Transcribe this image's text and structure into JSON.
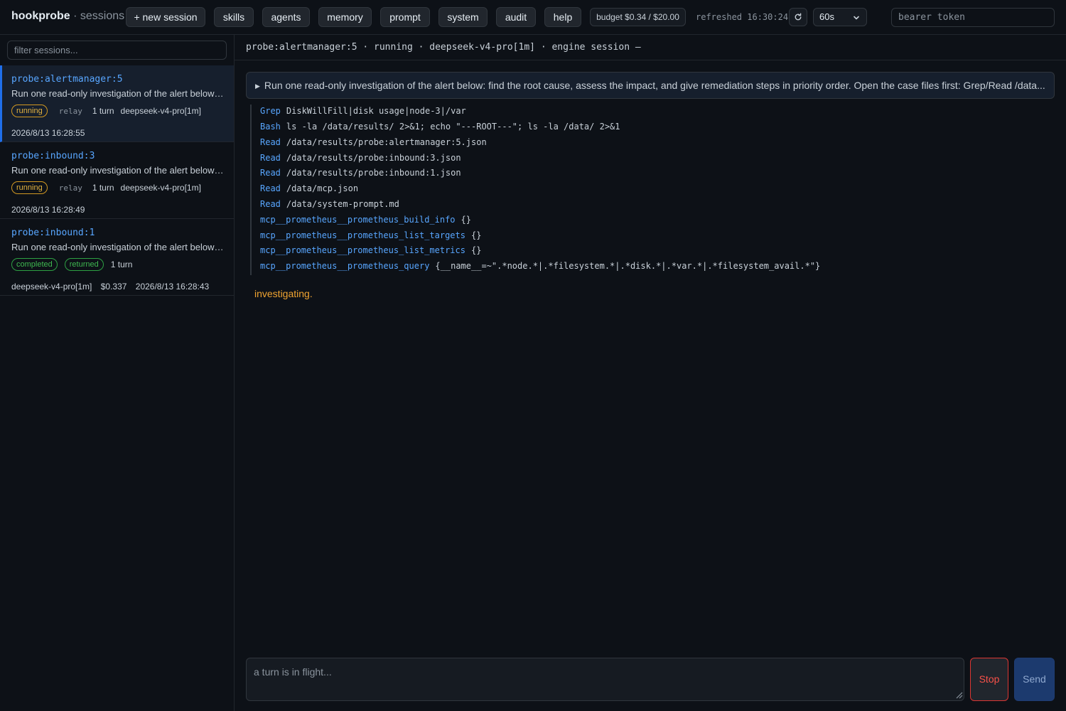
{
  "header": {
    "brand": "hookprobe",
    "section": "· sessions",
    "buttons": [
      "+ new session",
      "skills",
      "agents",
      "memory",
      "prompt",
      "system",
      "audit",
      "help"
    ],
    "budget": "budget $0.34 / $20.00",
    "refreshed": "refreshed 16:30:24",
    "refresh_icon": "refresh-icon",
    "interval": "60s",
    "token_placeholder": "bearer token"
  },
  "sidebar": {
    "filter_placeholder": "filter sessions...",
    "sessions": [
      {
        "name": "probe:alertmanager:5",
        "description": "Run one read-only investigation of the alert below: ...",
        "status": "running",
        "tag": "relay",
        "turns": "1 turn",
        "model": "deepseek-v4-pro[1m]",
        "timestamp": "2026/8/13 16:28:55"
      },
      {
        "name": "probe:inbound:3",
        "description": "Run one read-only investigation of the alert below: ...",
        "status": "running",
        "tag": "relay",
        "turns": "1 turn",
        "model": "deepseek-v4-pro[1m]",
        "timestamp": "2026/8/13 16:28:49"
      },
      {
        "name": "probe:inbound:1",
        "description": "Run one read-only investigation of the alert below: ...",
        "status": "completed",
        "tag": "returned",
        "turns": "1 turn",
        "model": "deepseek-v4-pro[1m]",
        "cost": "$0.337",
        "timestamp": "2026/8/13 16:28:43"
      }
    ]
  },
  "main": {
    "session_header": "probe:alertmanager:5 · running · deepseek-v4-pro[1m] · engine session —",
    "prompt_summary": "Run one read-only investigation of the alert below: find the root cause, assess the impact, and give remediation steps in priority order. Open the case files first: Grep/Read /data...",
    "tool_calls": [
      {
        "tool": "Grep",
        "args": "DiskWillFill|disk usage|node-3|/var"
      },
      {
        "tool": "Bash",
        "args": "ls -la /data/results/ 2>&1; echo \"---ROOT---\"; ls -la /data/ 2>&1"
      },
      {
        "tool": "Read",
        "args": "/data/results/probe:alertmanager:5.json"
      },
      {
        "tool": "Read",
        "args": "/data/results/probe:inbound:3.json"
      },
      {
        "tool": "Read",
        "args": "/data/results/probe:inbound:1.json"
      },
      {
        "tool": "Read",
        "args": "/data/mcp.json"
      },
      {
        "tool": "Read",
        "args": "/data/system-prompt.md"
      },
      {
        "tool": "mcp__prometheus__prometheus_build_info",
        "args": "{}"
      },
      {
        "tool": "mcp__prometheus__prometheus_list_targets",
        "args": "{}"
      },
      {
        "tool": "mcp__prometheus__prometheus_list_metrics",
        "args": "{}"
      },
      {
        "tool": "mcp__prometheus__prometheus_query",
        "args": "{__name__=~\".*node.*|.*filesystem.*|.*disk.*|.*var.*|.*filesystem_avail.*\"}"
      }
    ],
    "status": "investigating.",
    "composer_placeholder": "a turn is in flight...",
    "stop_label": "Stop",
    "send_label": "Send"
  },
  "colors": {
    "background": "#0d1117",
    "accent": "#58a6ff",
    "running": "#d29922",
    "completed": "#2ea043",
    "status_text": "#f0a431",
    "stop": "#f85149",
    "send": "#1c3a6e"
  }
}
